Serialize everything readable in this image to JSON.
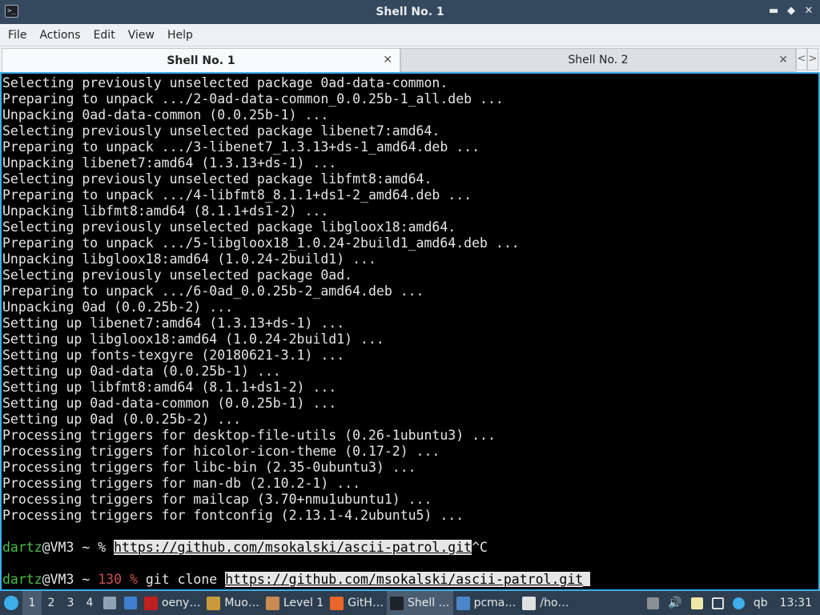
{
  "window": {
    "title": "Shell No. 1",
    "buttons": {
      "minimize": "▬",
      "restore": "◆",
      "close": "✕"
    }
  },
  "menu": [
    "File",
    "Actions",
    "Edit",
    "View",
    "Help"
  ],
  "tabs": [
    {
      "label": "Shell No. 1",
      "active": true
    },
    {
      "label": "Shell No. 2",
      "active": false
    }
  ],
  "terminal": {
    "lines": [
      "Selecting previously unselected package 0ad-data-common.",
      "Preparing to unpack .../2-0ad-data-common_0.0.25b-1_all.deb ...",
      "Unpacking 0ad-data-common (0.0.25b-1) ...",
      "Selecting previously unselected package libenet7:amd64.",
      "Preparing to unpack .../3-libenet7_1.3.13+ds-1_amd64.deb ...",
      "Unpacking libenet7:amd64 (1.3.13+ds-1) ...",
      "Selecting previously unselected package libfmt8:amd64.",
      "Preparing to unpack .../4-libfmt8_8.1.1+ds1-2_amd64.deb ...",
      "Unpacking libfmt8:amd64 (8.1.1+ds1-2) ...",
      "Selecting previously unselected package libgloox18:amd64.",
      "Preparing to unpack .../5-libgloox18_1.0.24-2build1_amd64.deb ...",
      "Unpacking libgloox18:amd64 (1.0.24-2build1) ...",
      "Selecting previously unselected package 0ad.",
      "Preparing to unpack .../6-0ad_0.0.25b-2_amd64.deb ...",
      "Unpacking 0ad (0.0.25b-2) ...",
      "Setting up libenet7:amd64 (1.3.13+ds-1) ...",
      "Setting up libgloox18:amd64 (1.0.24-2build1) ...",
      "Setting up fonts-texgyre (20180621-3.1) ...",
      "Setting up 0ad-data (0.0.25b-1) ...",
      "Setting up libfmt8:amd64 (8.1.1+ds1-2) ...",
      "Setting up 0ad-data-common (0.0.25b-1) ...",
      "Setting up 0ad (0.0.25b-2) ...",
      "Processing triggers for desktop-file-utils (0.26-1ubuntu3) ...",
      "Processing triggers for hicolor-icon-theme (0.17-2) ...",
      "Processing triggers for libc-bin (2.35-0ubuntu3) ...",
      "Processing triggers for man-db (2.10.2-1) ...",
      "Processing triggers for mailcap (3.70+nmu1ubuntu1) ...",
      "Processing triggers for fontconfig (2.13.1-4.2ubuntu5) ..."
    ],
    "prompt1": {
      "user": "dartz",
      "host_path": "@VM3 ~ % ",
      "url": "https://github.com/msokalski/ascii-patrol.git",
      "suffix": "^C"
    },
    "prompt2": {
      "user": "dartz",
      "host_path": "@VM3 ~ ",
      "exit_code": "130 % ",
      "command": "git clone ",
      "url": "https://github.com/msokalski/ascii-patrol.git"
    }
  },
  "taskbar": {
    "desktops": [
      "1",
      "2",
      "3",
      "4"
    ],
    "active_desktop": "1",
    "tasks": [
      {
        "label": "oeny…",
        "icon": "filezilla-icon",
        "color": "#bf1f1f"
      },
      {
        "label": "Muo…",
        "icon": "package-icon",
        "color": "#c89a3a"
      },
      {
        "label": "Level 1",
        "icon": "boot-icon",
        "color": "#c88a52"
      },
      {
        "label": "GitH…",
        "icon": "firefox-icon",
        "color": "#e8662a"
      },
      {
        "label": "Shell …",
        "icon": "terminal-icon",
        "color": "#1d2329",
        "active": true
      },
      {
        "label": "pcma…",
        "icon": "file-manager-icon",
        "color": "#4a86c8"
      },
      {
        "label": "/ho…",
        "icon": "text-editor-icon",
        "color": "#e0e0e0"
      }
    ],
    "tray_label": "qb",
    "clock": "13:31"
  }
}
